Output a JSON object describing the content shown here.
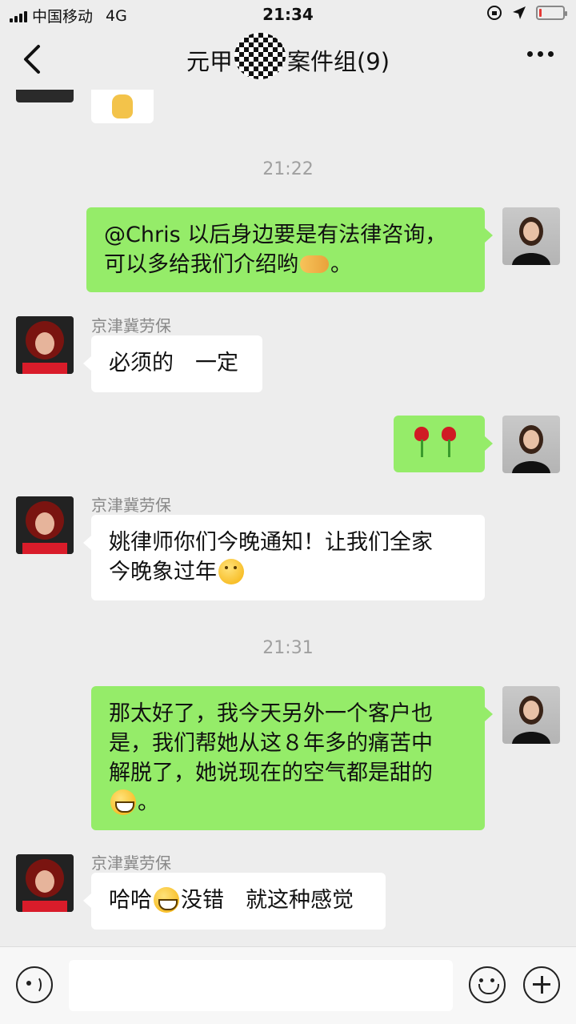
{
  "status_bar": {
    "carrier": "中国移动",
    "network": "4G",
    "time": "21:34",
    "battery_level": 0.12,
    "battery_color": "#e53935"
  },
  "nav": {
    "title_prefix": "元甲",
    "title_suffix": "案件组(9)",
    "back_icon": "chevron-left-icon",
    "more_icon": "more-dots-icon"
  },
  "messages": [
    {
      "type": "timestamp",
      "text": "21:22"
    },
    {
      "type": "out",
      "text_line1": "@Chris 以后身边要是有法律咨询，",
      "text_line2_a": "可以多给我们介绍哟",
      "text_line2_b": "。",
      "emoji": "handshake-icon"
    },
    {
      "type": "in",
      "sender": "京津冀劳保",
      "text": "必须的　一定"
    },
    {
      "type": "out",
      "emoji": "rose-icon"
    },
    {
      "type": "in",
      "sender": "京津冀劳保",
      "text_line1": "姚律师你们今晚通知！让我们全家",
      "text_line2": "今晚象过年",
      "emoji": "thinking-face-icon"
    },
    {
      "type": "timestamp",
      "text": "21:31"
    },
    {
      "type": "out",
      "text_line1": "那太好了，我今天另外一个客户也",
      "text_line2": "是，我们帮她从这８年多的痛苦中",
      "text_line3": "解脱了，她说现在的空气都是甜的",
      "text_line4": "。",
      "emoji": "grinning-face-icon"
    },
    {
      "type": "in",
      "sender": "京津冀劳保",
      "text_a": "哈哈",
      "text_b": "没错　就这种感觉",
      "emoji": "smile-face-icon"
    }
  ],
  "colors": {
    "outgoing_bubble": "#95ec69",
    "incoming_bubble": "#ffffff",
    "background": "#ededed"
  },
  "input_bar": {
    "value": "",
    "voice_icon": "voice-icon",
    "emoji_icon": "emoji-icon",
    "plus_icon": "plus-icon"
  }
}
